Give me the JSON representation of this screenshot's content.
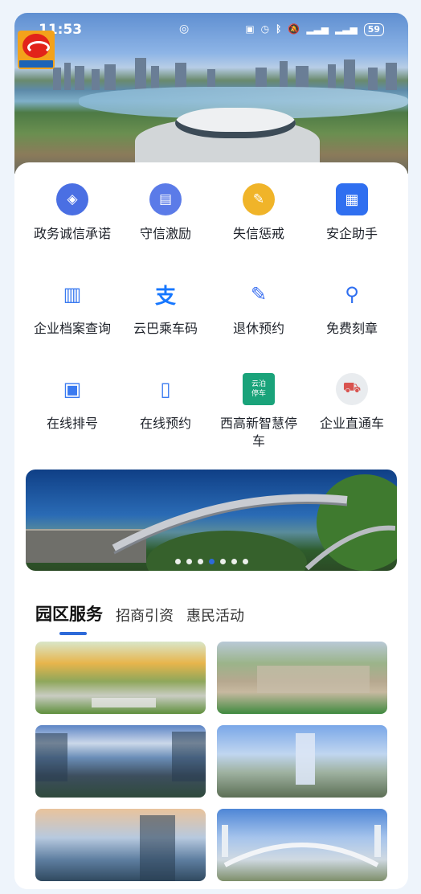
{
  "status_bar": {
    "time": "11:53",
    "battery": "59",
    "signal_icons": [
      "nfc-icon",
      "vibrate-icon",
      "alarm-icon",
      "bluetooth-icon",
      "mute-icon",
      "signal-icon",
      "signal-icon"
    ]
  },
  "hero": {
    "description_icon": "city-skyline-image"
  },
  "services_grid": [
    {
      "label": "政务诚信承诺",
      "icon": "shield-check-icon",
      "color": "#4a6fe3"
    },
    {
      "label": "守信激励",
      "icon": "award-doc-icon",
      "color": "#5b7be8"
    },
    {
      "label": "失信惩戒",
      "icon": "warning-doc-icon",
      "color": "#f0b429"
    },
    {
      "label": "安企助手",
      "icon": "assistant-icon",
      "color": "#2f6ff0"
    },
    {
      "label": "企业档案查询",
      "icon": "archive-search-icon",
      "color": "#3a7af0"
    },
    {
      "label": "云巴乘车码",
      "icon": "alipay-icon",
      "color": "#1677ff"
    },
    {
      "label": "退休预约",
      "icon": "edit-appointment-icon",
      "color": "#3a6ff0"
    },
    {
      "label": "免费刻章",
      "icon": "stamp-icon",
      "color": "#2f6ff0"
    },
    {
      "label": "在线排号",
      "icon": "queue-ticket-icon",
      "color": "#3a7af0"
    },
    {
      "label": "在线预约",
      "icon": "phone-booking-icon",
      "color": "#3a7af0"
    },
    {
      "label": "西高新智慧停车",
      "icon": "parking-icon",
      "color": "#1aa37a"
    },
    {
      "label": "企业直通车",
      "icon": "bus-icon",
      "color": "#d9534f"
    }
  ],
  "parking_icon_text": [
    "云泊",
    "停车"
  ],
  "banner": {
    "dots_total": 7,
    "active_dot": 3
  },
  "park_section": {
    "tabs": [
      "园区服务",
      "招商引资",
      "惠民活动"
    ],
    "active_tab": 0
  }
}
